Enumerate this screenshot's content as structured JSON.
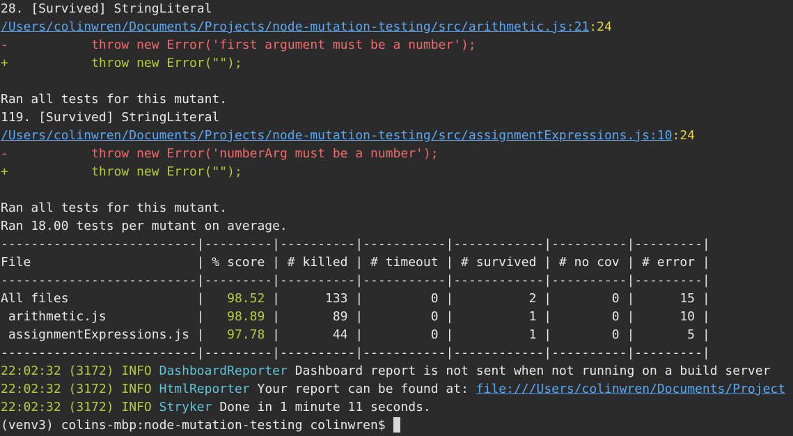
{
  "colors": {
    "background": "#2b2b2b",
    "text": "#e8e8e8",
    "link": "#5aa6f2",
    "line_number": "#e7d34a",
    "removed": "#ef6b6b",
    "added": "#b8cc3a",
    "timestamp": "#b8cc3a",
    "reporter": "#5fc4d6",
    "score": "#b8cc3a"
  },
  "mutants": [
    {
      "header": "28. [Survived] StringLiteral",
      "path": "/Users/colinwren/Documents/Projects/node-mutation-testing/src/arithmetic.js:21",
      "col": ":24",
      "removed_sign": "-",
      "removed_code": "throw new Error('first argument must be a number');",
      "added_sign": "+",
      "added_code": "throw new Error(\"\");",
      "footer": "Ran all tests for this mutant."
    },
    {
      "header": "119. [Survived] StringLiteral",
      "path": "/Users/colinwren/Documents/Projects/node-mutation-testing/src/assignmentExpressions.js:10",
      "col": ":24",
      "removed_sign": "-",
      "removed_code": "throw new Error('numberArg must be a number');",
      "added_sign": "+",
      "added_code": "throw new Error(\"\");",
      "footer": "Ran all tests for this mutant."
    }
  ],
  "average_line": "Ran 18.00 tests per mutant on average.",
  "table": {
    "separator": "--------------------------|---------|----------|-----------|------------|----------|---------|",
    "header_row": "File                      | % score | # killed | # timeout | # survived | # no cov | # error |",
    "rows": [
      {
        "file": "All files                 |",
        "score": "98.52",
        "rest": " |      133 |         0 |          2 |        0 |      15 |"
      },
      {
        "file": " arithmetic.js            |",
        "score": "98.89",
        "rest": " |       89 |         0 |          1 |        0 |      10 |"
      },
      {
        "file": " assignmentExpressions.js |",
        "score": "97.78",
        "rest": " |       44 |         0 |          1 |        0 |       5 |"
      }
    ]
  },
  "logs": [
    {
      "time": "22:02:32 (3172)",
      "level": "INFO",
      "source": "DashboardReporter",
      "message": "Dashboard report is not sent when not running on a build server",
      "link": ""
    },
    {
      "time": "22:02:32 (3172)",
      "level": "INFO",
      "source": "HtmlReporter",
      "message": "Your report can be found at:",
      "link": "file:///Users/colinwren/Documents/Project"
    },
    {
      "time": "22:02:32 (3172)",
      "level": "INFO",
      "source": "Stryker",
      "message": "Done in 1 minute 11 seconds.",
      "link": ""
    }
  ],
  "prompt": "(venv3) colins-mbp:node-mutation-testing colinwren$ "
}
